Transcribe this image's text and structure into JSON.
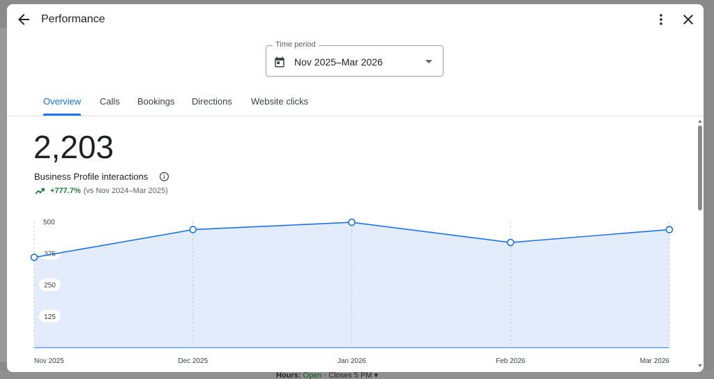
{
  "background": {
    "hours_label": "Hours:",
    "hours_status": "Open",
    "hours_closes": "· Closes 5 PM ▾"
  },
  "header": {
    "title": "Performance",
    "back_icon": "arrow-back-icon",
    "more_icon": "more-vert-icon",
    "close_icon": "close-icon"
  },
  "time_period": {
    "label": "Time period",
    "value": "Nov 2025–Mar 2026",
    "icon": "calendar-icon"
  },
  "tabs": [
    {
      "label": "Overview",
      "active": true
    },
    {
      "label": "Calls",
      "active": false
    },
    {
      "label": "Bookings",
      "active": false
    },
    {
      "label": "Directions",
      "active": false
    },
    {
      "label": "Website clicks",
      "active": false
    }
  ],
  "metric": {
    "value": "2,203",
    "label": "Business Profile interactions",
    "trend_value": "+777.7%",
    "trend_comparison": "(vs Nov 2024–Mar 2025)",
    "trend_color": "#188038"
  },
  "colors": {
    "accent": "#1a73e8",
    "area_fill": "#e3ecfb"
  },
  "chart_data": {
    "type": "area",
    "categories": [
      "Nov 2025",
      "Dec 2025",
      "Jan 2026",
      "Feb 2026",
      "Mar 2026"
    ],
    "values": [
      358,
      468,
      497,
      417,
      468
    ],
    "y_ticks": [
      125,
      250,
      375,
      500
    ],
    "ylim": [
      0,
      500
    ],
    "grid": "vertical dashed"
  }
}
